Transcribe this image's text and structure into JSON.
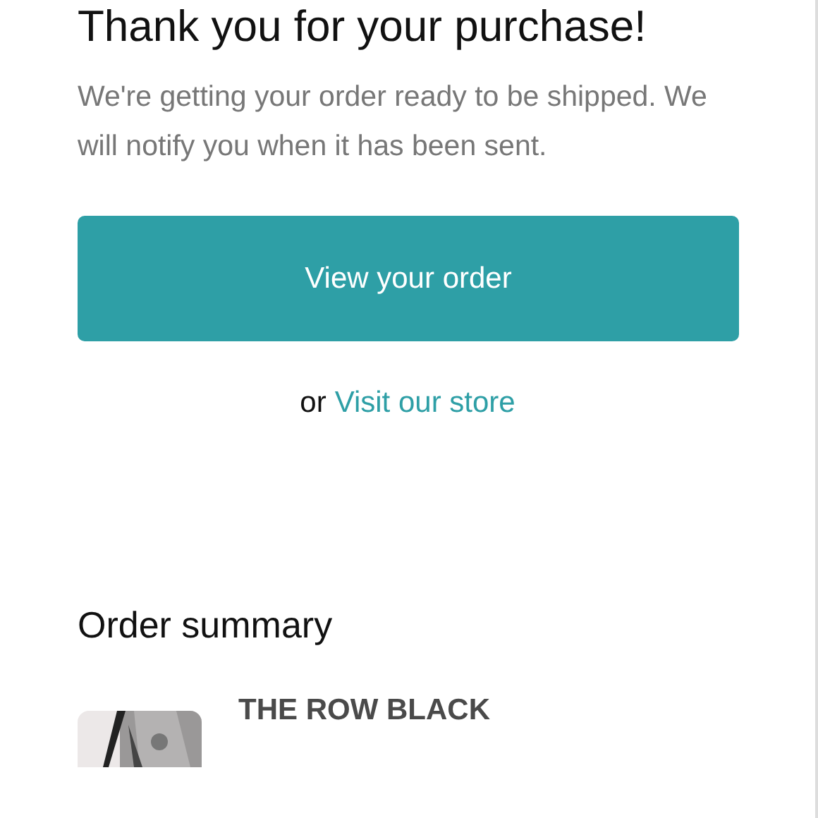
{
  "heading": "Thank you for your purchase!",
  "message": "We're getting your order ready to be shipped. We will notify you when it has been sent.",
  "primary_button": "View your order",
  "secondary": {
    "prefix": "or",
    "link": "Visit our store"
  },
  "summary": {
    "title": "Order summary",
    "items": [
      {
        "kind": "picture",
        "name": "THE ROW BLACK"
      }
    ]
  }
}
